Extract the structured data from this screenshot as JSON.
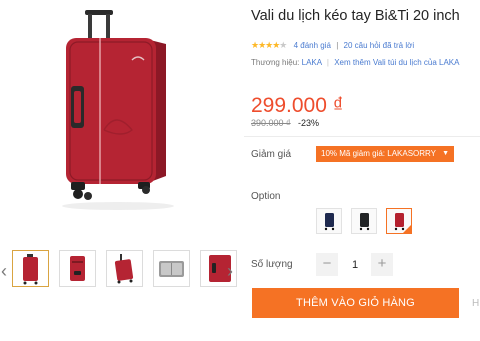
{
  "product": {
    "title": "Vali du lịch kéo tay Bi&Ti 20 inch",
    "rating_stars": 4,
    "review_count": "4 đánh giá",
    "qa_count": "20 câu hỏi đã trả lời",
    "brand_label": "Thương hiệu:",
    "brand_name": "LAKA",
    "brand_more": "Xem thêm Vali túi du lịch của LAKA"
  },
  "price": {
    "current": "299.000 ₫",
    "original": "390.000 ₫",
    "discount": "-23%"
  },
  "voucher": {
    "label": "Giảm giá",
    "tag": "10% Mã giảm giá: LAKASORRY"
  },
  "options": {
    "label": "Option",
    "colors": [
      "#1f2a4f",
      "#222426",
      "#b4212f"
    ],
    "selected_index": 2
  },
  "quantity": {
    "label": "Số lượng",
    "value": "1",
    "minus": "−",
    "plus": "+"
  },
  "actions": {
    "add_to_cart": "THÊM VÀO GIỎ HÀNG",
    "more": "H"
  },
  "gallery": {
    "prev": "‹",
    "next": "›",
    "selected_index": 0,
    "accent": "#f57224"
  }
}
